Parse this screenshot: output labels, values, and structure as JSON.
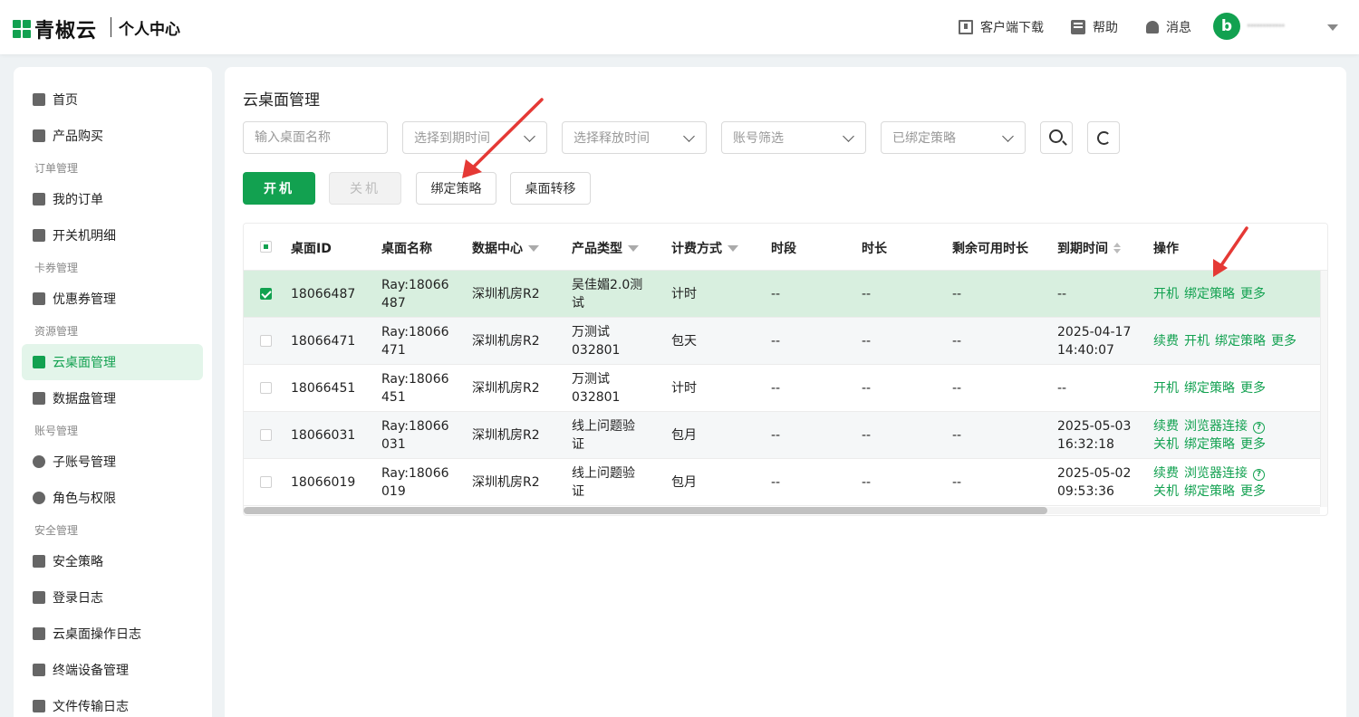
{
  "header": {
    "logo_text": "青椒云",
    "page_title": "个人中心",
    "download_label": "客户端下载",
    "help_label": "帮助",
    "messages_label": "消息",
    "avatar_letter": "b",
    "user_name": "············"
  },
  "sidebar": {
    "home": "首页",
    "purchase": "产品购买",
    "group_orders": "订单管理",
    "my_orders": "我的订单",
    "power_detail": "开关机明细",
    "group_cards": "卡券管理",
    "coupons": "优惠券管理",
    "group_resources": "资源管理",
    "cloud_desktop": "云桌面管理",
    "data_disk": "数据盘管理",
    "group_accounts": "账号管理",
    "sub_accounts": "子账号管理",
    "roles": "角色与权限",
    "group_security": "安全管理",
    "security_policy": "安全策略",
    "login_log": "登录日志",
    "desktop_op_log": "云桌面操作日志",
    "terminal_devices": "终端设备管理",
    "file_transfer_log": "文件传输日志"
  },
  "main": {
    "title": "云桌面管理",
    "filters": {
      "name_placeholder": "输入桌面名称",
      "expire_placeholder": "选择到期时间",
      "release_placeholder": "选择释放时间",
      "account_placeholder": "账号筛选",
      "policy_placeholder": "已绑定策略"
    },
    "actions": {
      "power_on": "开机",
      "power_off": "关机",
      "bind_policy": "绑定策略",
      "transfer": "桌面转移"
    },
    "columns": {
      "id": "桌面ID",
      "name": "桌面名称",
      "datacenter": "数据中心",
      "product": "产品类型",
      "billing": "计费方式",
      "period": "时段",
      "duration": "时长",
      "remaining": "剩余可用时长",
      "expire": "到期时间",
      "ops": "操作"
    },
    "rows": [
      {
        "id": "18066487",
        "name_1": "Ray:18066",
        "name_2": "487",
        "datacenter": "深圳机房R2",
        "product_1": "吴佳媚2.0测",
        "product_2": "试",
        "billing": "计时",
        "period": "--",
        "duration": "--",
        "remaining": "--",
        "expire_1": "--",
        "expire_2": "",
        "ops_1": [
          "开机",
          "绑定策略",
          "更多"
        ],
        "ops_2": []
      },
      {
        "id": "18066471",
        "name_1": "Ray:18066",
        "name_2": "471",
        "datacenter": "深圳机房R2",
        "product_1": "万测试",
        "product_2": "032801",
        "billing": "包天",
        "period": "--",
        "duration": "--",
        "remaining": "--",
        "expire_1": "2025-04-17",
        "expire_2": "14:40:07",
        "ops_1": [
          "续费",
          "开机",
          "绑定策略",
          "更多"
        ],
        "ops_2": []
      },
      {
        "id": "18066451",
        "name_1": "Ray:18066",
        "name_2": "451",
        "datacenter": "深圳机房R2",
        "product_1": "万测试",
        "product_2": "032801",
        "billing": "计时",
        "period": "--",
        "duration": "--",
        "remaining": "--",
        "expire_1": "--",
        "expire_2": "",
        "ops_1": [
          "开机",
          "绑定策略",
          "更多"
        ],
        "ops_2": []
      },
      {
        "id": "18066031",
        "name_1": "Ray:18066",
        "name_2": "031",
        "datacenter": "深圳机房R2",
        "product_1": "线上问题验",
        "product_2": "证",
        "billing": "包月",
        "period": "--",
        "duration": "--",
        "remaining": "--",
        "expire_1": "2025-05-03",
        "expire_2": "16:32:18",
        "ops_1": [
          "续费",
          "浏览器连接"
        ],
        "ops_2": [
          "关机",
          "绑定策略",
          "更多"
        ]
      },
      {
        "id": "18066019",
        "name_1": "Ray:18066",
        "name_2": "019",
        "datacenter": "深圳机房R2",
        "product_1": "线上问题验",
        "product_2": "证",
        "billing": "包月",
        "period": "--",
        "duration": "--",
        "remaining": "--",
        "expire_1": "2025-05-02",
        "expire_2": "09:53:36",
        "ops_1": [
          "续费",
          "浏览器连接"
        ],
        "ops_2": [
          "关机",
          "绑定策略",
          "更多"
        ]
      }
    ]
  },
  "colors": {
    "accent": "#12a150",
    "annotation_arrow": "#e53935",
    "selected_row": "#d8efdf"
  }
}
